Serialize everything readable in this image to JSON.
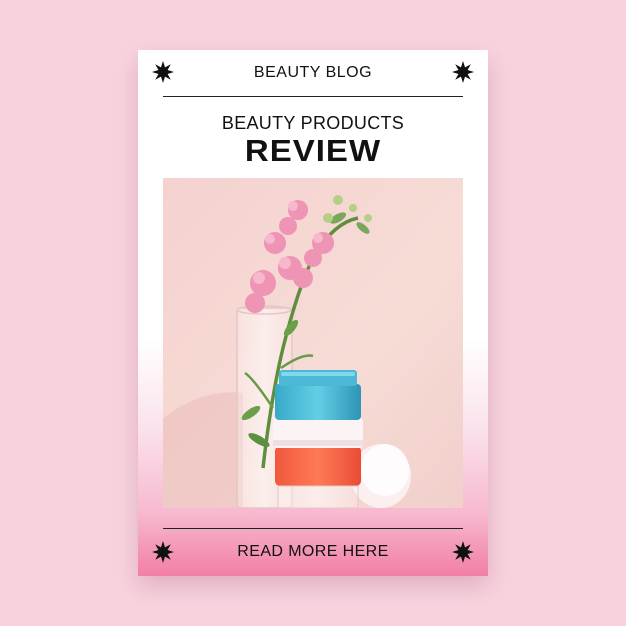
{
  "header": {
    "title": "BEAUTY BLOG"
  },
  "main": {
    "subtitle": "BEAUTY PRODUCTS",
    "headline": "REVIEW"
  },
  "footer": {
    "cta": "READ MORE HERE"
  },
  "icons": {
    "corner": "sparkle-star-icon",
    "photo": "flower-and-cream-jars-photo"
  },
  "colors": {
    "page_background": "#f8d3de",
    "card_gradient_end": "#f27fa6",
    "text": "#111111"
  }
}
